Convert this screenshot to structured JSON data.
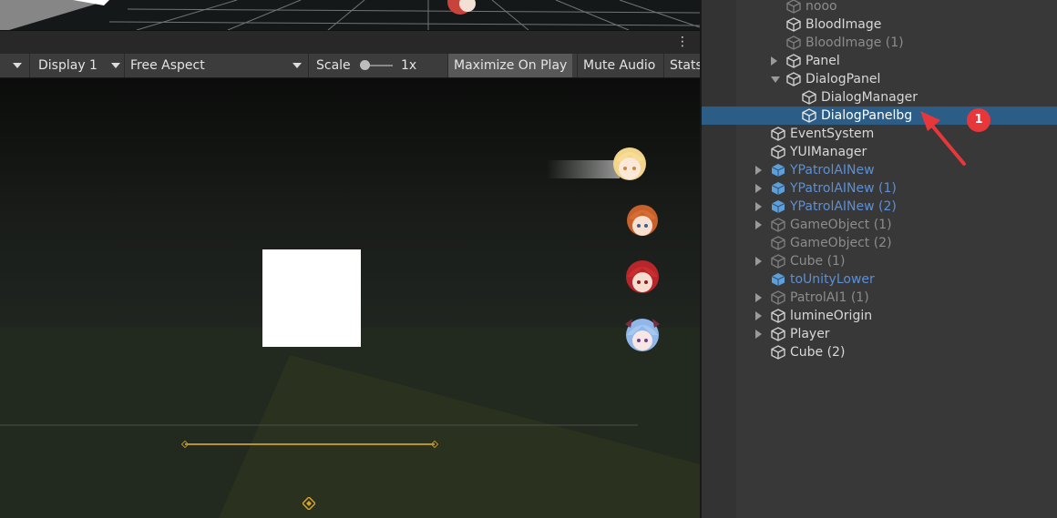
{
  "toolbar": {
    "display": "Display 1",
    "aspect": "Free Aspect",
    "scale_label": "Scale",
    "scale_value": "1x",
    "maximize": "Maximize On Play",
    "mute": "Mute Audio",
    "stats": "Stats"
  },
  "hierarchy": {
    "rows": [
      {
        "label": "nooo",
        "fold": "",
        "state": "dim",
        "prefab": false
      },
      {
        "label": "BloodImage",
        "fold": "",
        "state": "normal",
        "prefab": false
      },
      {
        "label": "BloodImage (1)",
        "fold": "",
        "state": "dim",
        "prefab": false
      },
      {
        "label": "Panel",
        "fold": "right",
        "state": "normal",
        "prefab": false
      },
      {
        "label": "DialogPanel",
        "fold": "down",
        "state": "normal",
        "prefab": false
      },
      {
        "label": "DialogManager",
        "fold": "",
        "state": "normal",
        "prefab": false
      },
      {
        "label": "DialogPanelbg",
        "fold": "",
        "state": "selected",
        "prefab": false
      },
      {
        "label": "EventSystem",
        "fold": "",
        "state": "normal",
        "prefab": false
      },
      {
        "label": "YUIManager",
        "fold": "",
        "state": "normal",
        "prefab": false
      },
      {
        "label": "YPatrolAINew",
        "fold": "right",
        "state": "prefab",
        "prefab": true
      },
      {
        "label": "YPatrolAINew (1)",
        "fold": "right",
        "state": "prefab",
        "prefab": true
      },
      {
        "label": "YPatrolAINew (2)",
        "fold": "right",
        "state": "prefab",
        "prefab": true
      },
      {
        "label": "GameObject (1)",
        "fold": "right",
        "state": "dim",
        "prefab": false
      },
      {
        "label": "GameObject (2)",
        "fold": "",
        "state": "dim",
        "prefab": false
      },
      {
        "label": "Cube (1)",
        "fold": "right",
        "state": "dim",
        "prefab": false
      },
      {
        "label": "toUnityLower",
        "fold": "",
        "state": "prefab",
        "prefab": true
      },
      {
        "label": "PatrolAI1 (1)",
        "fold": "right",
        "state": "dim",
        "prefab": false
      },
      {
        "label": "lumineOrigin",
        "fold": "right",
        "state": "normal",
        "prefab": false
      },
      {
        "label": "Player",
        "fold": "right",
        "state": "normal",
        "prefab": false
      },
      {
        "label": "Cube (2)",
        "fold": "",
        "state": "normal",
        "prefab": false
      }
    ]
  },
  "annotation": {
    "badge": "1"
  },
  "colors": {
    "selection": "#2c5d87",
    "prefab_text": "#5c8fd6",
    "badge": "#e8373a",
    "gold": "#b8932c"
  }
}
